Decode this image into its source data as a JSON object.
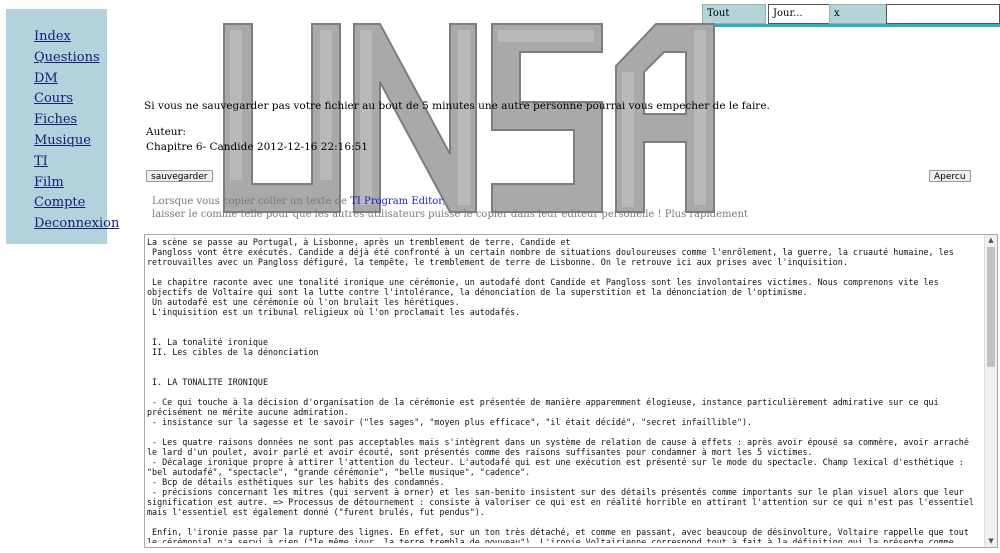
{
  "topbar": {
    "filter_all": "Tout",
    "filter_date": "Jour...",
    "clear": "x",
    "search_value": ""
  },
  "sidebar": {
    "items": [
      {
        "label": "Index"
      },
      {
        "label": "Questions"
      },
      {
        "label": "DM"
      },
      {
        "label": "Cours"
      },
      {
        "label": "Fiches"
      },
      {
        "label": "Musique"
      },
      {
        "label": "TI"
      },
      {
        "label": "Film"
      },
      {
        "label": "Compte"
      },
      {
        "label": "Deconnexion"
      }
    ]
  },
  "notice": "Si vous ne sauvegarder pas votre fichier au bout de 5 minutes une autre personne pourrai vous empecher de le faire.",
  "meta": {
    "author_label": "Auteur:",
    "chapter": "Chapitre 6- Candide 2012-12-16 22:16:51"
  },
  "buttons": {
    "save": "sauvegarder",
    "preview": "Apercu"
  },
  "hint": {
    "line1_prefix": "Lorsque vous copier coller un texte de ",
    "line1_link": "TI Program Editor",
    "line1_suffix": ",",
    "line2": "laisser le comme telle pour que les autres utilisateurs puisse le copier dans leur editeur personelle ! Plus rapidement"
  },
  "editor": {
    "content": "La scène se passe au Portugal, à Lisbonne, après un tremblement de terre. Candide et\n Pangloss vont être exécutés. Candide a déjà été confronté à un certain nombre de situations douloureuses comme l'enrôlement, la guerre, la cruauté humaine, les retrouvailles avec un Pangloss défiguré, la tempête, le tremblement de terre de Lisbonne. On le retrouve ici aux prises avec l'inquisition.\n\n Le chapitre raconte avec une tonalité ironique une cérémonie, un autodafé dont Candide et Pangloss sont les involontaires victimes. Nous comprenons vite les objectifs de Voltaire qui sont la lutte contre l'intolérance, la dénonciation de la superstition et la dénonciation de l'optimisme.\n Un autodafé est une cérémonie où l'on brulait les hérétiques.\n L'inquisition est un tribunal religieux où l'on proclamait les autodafés.\n\n\n I. La tonalité ironique\n II. Les cibles de la dénonciation\n\n\n I. LA TONALITE IRONIQUE\n\n - Ce qui touche à la décision d'organisation de la cérémonie est présentée de manière apparemment élogieuse, instance particulièrement admirative sur ce qui précisément ne mérite aucune admiration.\n - insistance sur la sagesse et le savoir (\"les sages\", \"moyen plus efficace\", \"il était décidé\", \"secret infaillible\").\n\n - Les quatre raisons données ne sont pas acceptables mais s'intègrent dans un système de relation de cause à effets : après avoir épousé sa commère, avoir arraché le lard d'un poulet, avoir parlé et avoir écouté, sont présentés comme des raisons suffisantes pour condamner à mort les 5 victimes.\n - Décalage ironique propre à attirer l'attention du lecteur. L'autodafé qui est une exécution est présenté sur le mode du spectacle. Champ lexical d'esthétique : \"bel autodafé\", \"spectacle\", \"grande cérémonie\", \"belle musique\", \"cadence\".\n - Bcp de détails esthétiques sur les habits des condamnés.\n - précisions concernant les mitres (qui servent à orner) et les san-benito insistent sur des détails présentés comme importants sur le plan visuel alors que leur signification est autre. => Processus de détournement : consiste à valoriser ce qui est en réalité horrible en attirant l'attention sur ce qui n'est pas l'essentiel mais l'essentiel est également donné (\"furent brulés, fut pendus\").\n\n Enfin, l'ironie passe par la rupture des lignes. En effet, sur un ton très détaché, et comme en passant, avec beaucoup de désinvolture, Voltaire rappelle que tout le cérémonial n'a servi à rien (\"le même jour, la terre trembla de nouveau\"). L'ironie Voltairienne correspond tout à fait à la définition qui la présente comme"
  },
  "colors": {
    "sidebar_bg": "#b2d3dc",
    "topbar_stripe": "#2ab0c8",
    "link": "#1a1a7a"
  }
}
